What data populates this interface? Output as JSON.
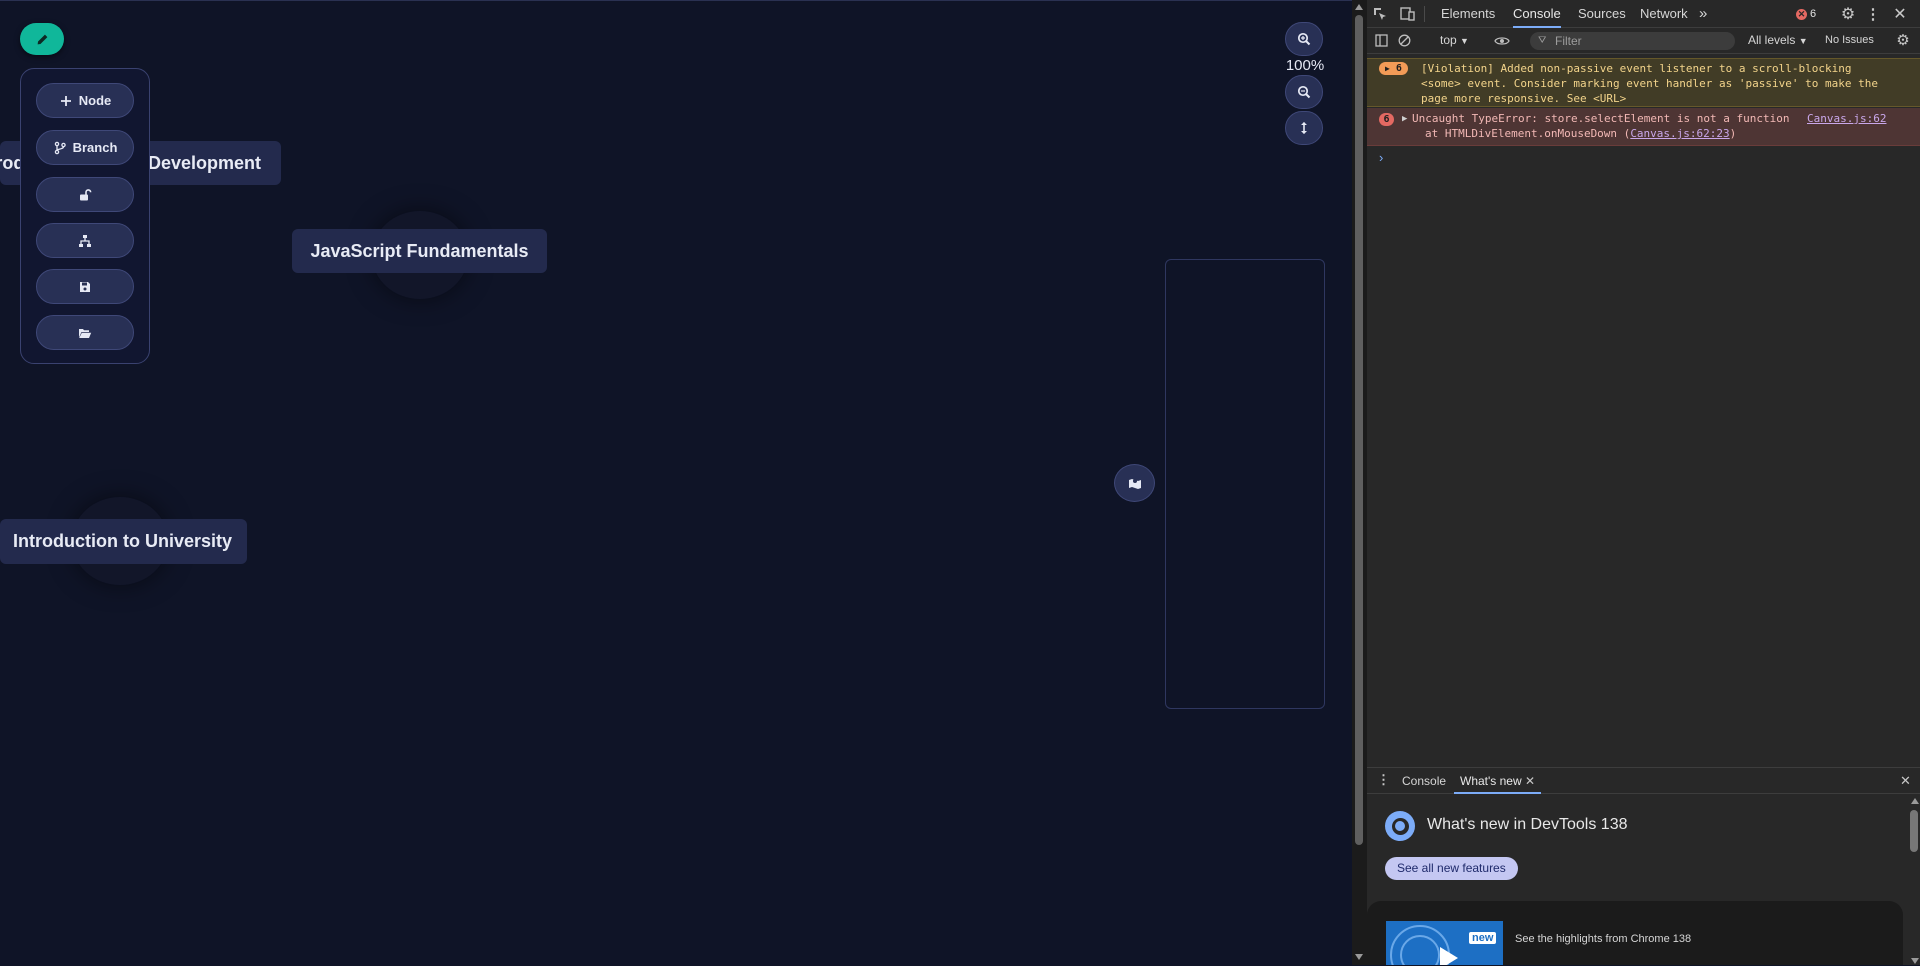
{
  "canvas": {
    "nodes": [
      {
        "name": "node-web-development",
        "label": "Introduction to Web Development"
      },
      {
        "name": "node-javascript-fundamentals",
        "label": "JavaScript Fundamentals"
      },
      {
        "name": "node-introduction-university",
        "label": "Introduction to University"
      }
    ],
    "zoom_level": "100%"
  },
  "toolbar": {
    "node_label": "Node",
    "branch_label": "Branch",
    "icons": [
      "pencil-icon",
      "plus-icon",
      "branch-icon",
      "unlock-icon",
      "sitemap-icon",
      "save-icon",
      "folder-open-icon",
      "zoom-in-icon",
      "zoom-out-icon",
      "fit-vertical-icon",
      "map-icon"
    ],
    "accent_color": "#10b79a"
  },
  "devtools": {
    "tabs": [
      "Elements",
      "Console",
      "Sources",
      "Network"
    ],
    "active_tab": "Console",
    "error_count": "6",
    "context": "top",
    "filter_placeholder": "Filter",
    "levels": "All levels",
    "issues": "No Issues",
    "messages": {
      "warning": {
        "count": "6",
        "line1": "[Violation] Added non-passive event listener to a scroll-blocking",
        "line2": "<some> event. Consider marking event handler as 'passive' to make the",
        "line3": "page more responsive. See <URL>"
      },
      "error": {
        "count": "6",
        "line1": "Uncaught TypeError: store.selectElement is not a function",
        "line2_prefix": "at HTMLDivElement.onMouseDown (",
        "line2_link": "Canvas.js:62:23",
        "line2_suffix": ")",
        "source": "Canvas.js:62"
      }
    },
    "drawer": {
      "tabs": [
        "Console",
        "What's new"
      ],
      "heading": "What's new in DevTools 138",
      "button": "See all new features",
      "card_badge": "new",
      "card_text": "See the highlights from Chrome 138"
    }
  }
}
